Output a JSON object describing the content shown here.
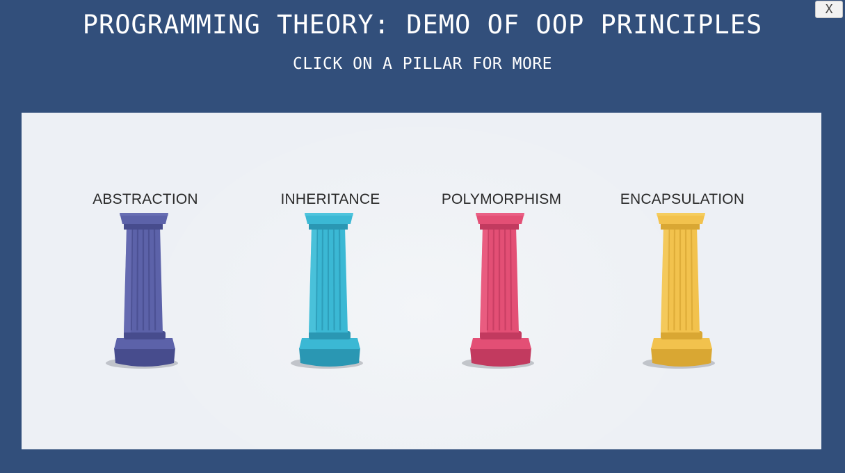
{
  "header": {
    "title": "PROGRAMMING THEORY: DEMO OF OOP PRINCIPLES",
    "subtitle": "CLICK ON A PILLAR FOR MORE",
    "close_label": "X"
  },
  "pillars": [
    {
      "label": "ABSTRACTION",
      "color": "#5c62a9",
      "shade": "#474c8d",
      "light": "#7076bb"
    },
    {
      "label": "INHERITANCE",
      "color": "#3bb8d4",
      "shade": "#2a97b3",
      "light": "#5ccbe3"
    },
    {
      "label": "POLYMORPHISM",
      "color": "#e34f75",
      "shade": "#c23a5f",
      "light": "#ef6c8f"
    },
    {
      "label": "ENCAPSULATION",
      "color": "#f2c24d",
      "shade": "#d9a733",
      "light": "#f7d36c"
    }
  ],
  "colors": {
    "background": "#324f7b",
    "panel": "#edf0f5",
    "text_light": "#ffffff",
    "text_dark": "#2a2a2a"
  }
}
